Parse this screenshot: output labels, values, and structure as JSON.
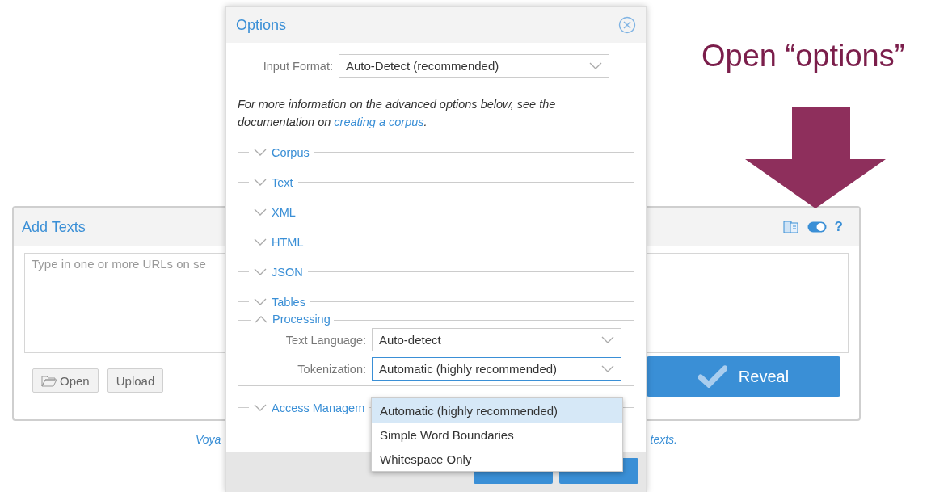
{
  "annotation": {
    "text": "Open “options”"
  },
  "panel": {
    "title": "Add Texts",
    "help": "?",
    "placeholder": "Type in one or more URLs on se",
    "buttons": [
      {
        "label": "Open",
        "kind": "folder"
      },
      {
        "label": "Upload",
        "kind": "plain"
      }
    ],
    "reveal": "Reveal",
    "footer_left": "Voya",
    "footer_right": "texts."
  },
  "dialog": {
    "title": "Options",
    "input_format": {
      "label": "Input Format:",
      "value": "Auto-Detect (recommended)"
    },
    "info": {
      "text": "For more information on the advanced options below, see the documentation on ",
      "link": "creating a corpus",
      "tail": "."
    },
    "sections": [
      {
        "title": "Corpus",
        "expanded": false
      },
      {
        "title": "Text",
        "expanded": false
      },
      {
        "title": "XML",
        "expanded": false
      },
      {
        "title": "HTML",
        "expanded": false
      },
      {
        "title": "JSON",
        "expanded": false
      },
      {
        "title": "Tables",
        "expanded": false
      },
      {
        "title": "Processing",
        "expanded": true,
        "fields": [
          {
            "label": "Text Language:",
            "value": "Auto-detect",
            "focused": false
          },
          {
            "label": "Tokenization:",
            "value": "Automatic (highly recommended)",
            "focused": true
          }
        ]
      },
      {
        "title": "Access Managem",
        "expanded": false
      }
    ],
    "dropdown": [
      {
        "label": "Automatic (highly recommended)",
        "selected": true
      },
      {
        "label": "Simple Word Boundaries",
        "selected": false
      },
      {
        "label": "Whitespace Only",
        "selected": false
      }
    ]
  }
}
